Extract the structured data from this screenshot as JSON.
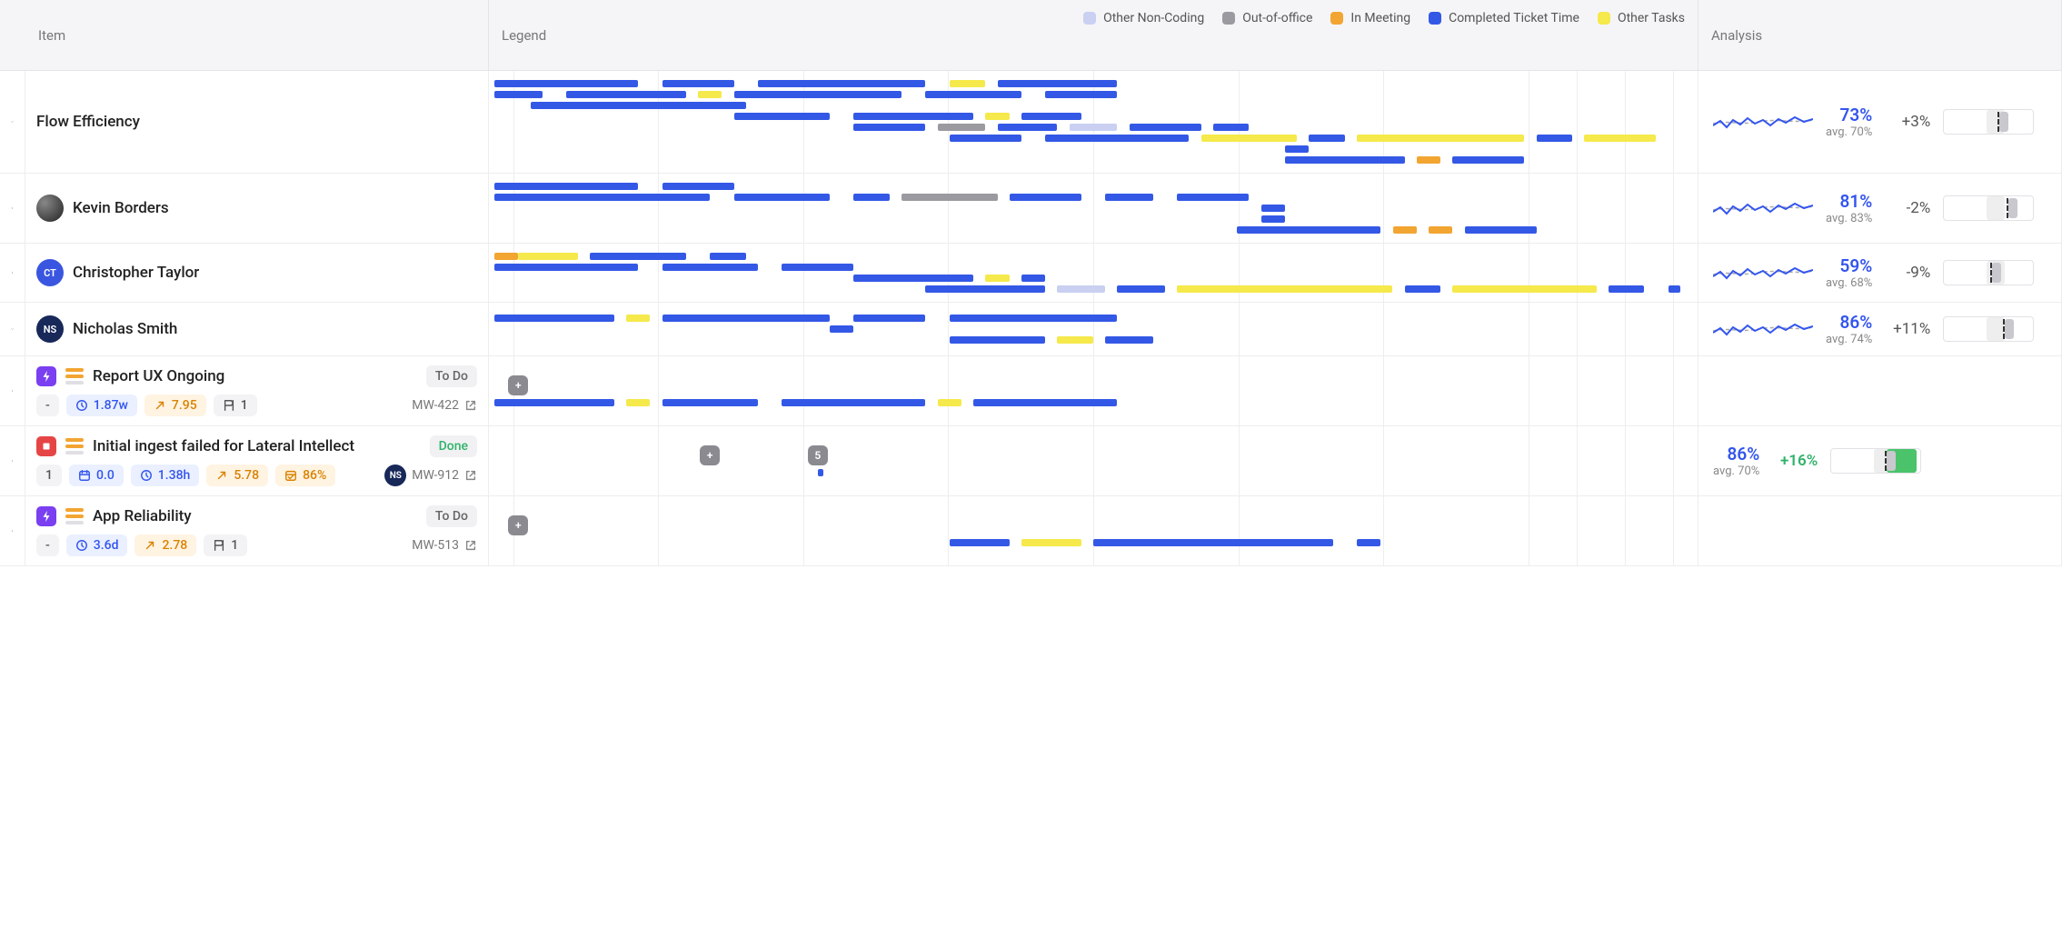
{
  "colors": {
    "blue": "#3458e6",
    "yellow": "#f5e94b",
    "lavender": "#c9d0f2",
    "grey": "#9a9aa0",
    "orange": "#f2a531",
    "green_bar": "#4bc36b"
  },
  "headers": {
    "item": "Item",
    "legend": "Legend",
    "analysis": "Analysis"
  },
  "legend": [
    {
      "label": "Other Non-Coding",
      "color": "lavender"
    },
    {
      "label": "Out-of-office",
      "color": "grey"
    },
    {
      "label": "In Meeting",
      "color": "orange"
    },
    {
      "label": "Completed Ticket Time",
      "color": "blue"
    },
    {
      "label": "Other Tasks",
      "color": "yellow"
    }
  ],
  "grid_lines_pct": [
    2,
    14,
    26,
    38,
    50,
    62,
    74,
    86,
    90,
    94,
    98
  ],
  "rows": [
    {
      "kind": "group",
      "expanded": true,
      "selected": true,
      "title": "Flow Efficiency",
      "analysis": {
        "spark": true,
        "value": "73%",
        "avg": "avg. 70%",
        "delta": "+3%",
        "knob_pct": 60
      },
      "tracks": [
        [
          {
            "c": "blue",
            "s": 0,
            "w": 12
          },
          {
            "c": "blue",
            "s": 14,
            "w": 6
          },
          {
            "c": "blue",
            "s": 22,
            "w": 14
          },
          {
            "c": "yellow",
            "s": 38,
            "w": 3
          },
          {
            "c": "blue",
            "s": 42,
            "w": 10
          }
        ],
        [
          {
            "c": "blue",
            "s": 0,
            "w": 4
          },
          {
            "c": "blue",
            "s": 6,
            "w": 10
          },
          {
            "c": "yellow",
            "s": 17,
            "w": 2
          },
          {
            "c": "blue",
            "s": 20,
            "w": 14
          },
          {
            "c": "blue",
            "s": 36,
            "w": 8
          },
          {
            "c": "blue",
            "s": 46,
            "w": 6
          }
        ],
        [
          {
            "c": "blue",
            "s": 3,
            "w": 18
          }
        ],
        [
          {
            "c": "blue",
            "s": 20,
            "w": 8
          },
          {
            "c": "blue",
            "s": 30,
            "w": 10
          },
          {
            "c": "yellow",
            "s": 41,
            "w": 2
          },
          {
            "c": "blue",
            "s": 44,
            "w": 5
          }
        ],
        [
          {
            "c": "blue",
            "s": 30,
            "w": 6
          },
          {
            "c": "grey",
            "s": 37,
            "w": 4
          },
          {
            "c": "blue",
            "s": 42,
            "w": 5
          },
          {
            "c": "lavender",
            "s": 48,
            "w": 4
          },
          {
            "c": "blue",
            "s": 53,
            "w": 6
          },
          {
            "c": "blue",
            "s": 60,
            "w": 3
          }
        ],
        [
          {
            "c": "blue",
            "s": 38,
            "w": 6
          },
          {
            "c": "blue",
            "s": 46,
            "w": 12
          },
          {
            "c": "yellow",
            "s": 59,
            "w": 8
          },
          {
            "c": "blue",
            "s": 68,
            "w": 3
          },
          {
            "c": "yellow",
            "s": 72,
            "w": 14
          },
          {
            "c": "blue",
            "s": 87,
            "w": 3
          },
          {
            "c": "yellow",
            "s": 91,
            "w": 6
          }
        ],
        [
          {
            "c": "blue",
            "s": 66,
            "w": 2
          }
        ],
        [
          {
            "c": "blue",
            "s": 66,
            "w": 10
          },
          {
            "c": "orange",
            "s": 77,
            "w": 2
          },
          {
            "c": "blue",
            "s": 80,
            "w": 6
          }
        ]
      ]
    },
    {
      "kind": "person",
      "expanded": false,
      "title": "Kevin Borders",
      "avatar": {
        "type": "img"
      },
      "analysis": {
        "spark": true,
        "value": "81%",
        "avg": "avg. 83%",
        "delta": "-2%",
        "knob_pct": 70
      },
      "tracks": [
        [
          {
            "c": "blue",
            "s": 0,
            "w": 12
          },
          {
            "c": "blue",
            "s": 14,
            "w": 6
          }
        ],
        [
          {
            "c": "blue",
            "s": 0,
            "w": 18
          },
          {
            "c": "blue",
            "s": 20,
            "w": 8
          },
          {
            "c": "blue",
            "s": 30,
            "w": 3
          },
          {
            "c": "grey",
            "s": 34,
            "w": 8
          },
          {
            "c": "blue",
            "s": 43,
            "w": 6
          },
          {
            "c": "blue",
            "s": 51,
            "w": 4
          },
          {
            "c": "blue",
            "s": 57,
            "w": 6
          }
        ],
        [
          {
            "c": "blue",
            "s": 64,
            "w": 2
          }
        ],
        [
          {
            "c": "blue",
            "s": 64,
            "w": 2
          }
        ],
        [
          {
            "c": "blue",
            "s": 62,
            "w": 12
          },
          {
            "c": "orange",
            "s": 75,
            "w": 2
          },
          {
            "c": "orange",
            "s": 78,
            "w": 2
          },
          {
            "c": "blue",
            "s": 81,
            "w": 6
          }
        ]
      ]
    },
    {
      "kind": "person",
      "expanded": false,
      "title": "Christopher Taylor",
      "avatar": {
        "type": "init",
        "text": "CT",
        "bg": "#3a56e0"
      },
      "analysis": {
        "spark": true,
        "value": "59%",
        "avg": "avg. 68%",
        "delta": "-9%",
        "knob_pct": 52
      },
      "tracks": [
        [
          {
            "c": "orange",
            "s": 0,
            "w": 2
          },
          {
            "c": "yellow",
            "s": 2,
            "w": 5
          },
          {
            "c": "blue",
            "s": 8,
            "w": 8
          },
          {
            "c": "blue",
            "s": 18,
            "w": 3
          }
        ],
        [
          {
            "c": "blue",
            "s": 0,
            "w": 12
          },
          {
            "c": "blue",
            "s": 14,
            "w": 8
          },
          {
            "c": "blue",
            "s": 24,
            "w": 6
          }
        ],
        [
          {
            "c": "blue",
            "s": 30,
            "w": 10
          },
          {
            "c": "yellow",
            "s": 41,
            "w": 2
          },
          {
            "c": "blue",
            "s": 44,
            "w": 2
          }
        ],
        [
          {
            "c": "blue",
            "s": 36,
            "w": 10
          },
          {
            "c": "lavender",
            "s": 47,
            "w": 4
          },
          {
            "c": "blue",
            "s": 52,
            "w": 4
          },
          {
            "c": "yellow",
            "s": 57,
            "w": 18
          },
          {
            "c": "blue",
            "s": 76,
            "w": 3
          },
          {
            "c": "yellow",
            "s": 80,
            "w": 12
          },
          {
            "c": "blue",
            "s": 93,
            "w": 3
          },
          {
            "c": "blue",
            "s": 98,
            "w": 1
          }
        ]
      ]
    },
    {
      "kind": "person",
      "expanded": true,
      "title": "Nicholas Smith",
      "avatar": {
        "type": "init",
        "text": "NS",
        "bg": "#172859"
      },
      "analysis": {
        "spark": true,
        "value": "86%",
        "avg": "avg. 74%",
        "delta": "+11%",
        "knob_pct": 66
      },
      "tracks": [
        [
          {
            "c": "blue",
            "s": 0,
            "w": 10
          },
          {
            "c": "yellow",
            "s": 11,
            "w": 2
          },
          {
            "c": "blue",
            "s": 14,
            "w": 14
          },
          {
            "c": "blue",
            "s": 30,
            "w": 6
          },
          {
            "c": "blue",
            "s": 38,
            "w": 14
          }
        ],
        [
          {
            "c": "blue",
            "s": 28,
            "w": 2
          }
        ],
        [
          {
            "c": "blue",
            "s": 38,
            "w": 8
          },
          {
            "c": "yellow",
            "s": 47,
            "w": 3
          },
          {
            "c": "blue",
            "s": 51,
            "w": 4
          }
        ]
      ]
    },
    {
      "kind": "ticket",
      "title": "Report UX Ongoing",
      "status": {
        "text": "To Do",
        "cls": ""
      },
      "type_icon": {
        "bg": "#7a3ff0",
        "glyph": "bolt"
      },
      "priority": [
        "#f2a531",
        "#f2a531",
        "#e0e0e4"
      ],
      "badges": [
        {
          "cls": "",
          "text": "-"
        },
        {
          "cls": "blue",
          "icon": "clock",
          "text": "1.87w"
        },
        {
          "cls": "orange",
          "icon": "arrow-up-right",
          "text": "7.95"
        },
        {
          "cls": "",
          "icon": "flag",
          "text": "1"
        }
      ],
      "ticket": "MW-422",
      "markers": [
        {
          "pct": 2,
          "text": "+"
        }
      ],
      "tracks": [
        [
          {
            "c": "blue",
            "s": 0,
            "w": 10
          },
          {
            "c": "yellow",
            "s": 11,
            "w": 2
          },
          {
            "c": "blue",
            "s": 14,
            "w": 8
          },
          {
            "c": "blue",
            "s": 24,
            "w": 12
          },
          {
            "c": "yellow",
            "s": 37,
            "w": 2
          },
          {
            "c": "blue",
            "s": 40,
            "w": 12
          }
        ]
      ]
    },
    {
      "kind": "ticket",
      "title": "Initial ingest failed for Lateral Intellect",
      "status": {
        "text": "Done",
        "cls": "done"
      },
      "type_icon": {
        "bg": "#e64545",
        "glyph": "stop"
      },
      "priority": [
        "#f2a531",
        "#f2a531",
        "#e0e0e4"
      ],
      "badges": [
        {
          "cls": "",
          "text": "1"
        },
        {
          "cls": "blue",
          "icon": "calendar",
          "text": "0.0"
        },
        {
          "cls": "blue",
          "icon": "clock",
          "text": "1.38h"
        },
        {
          "cls": "orange",
          "icon": "arrow-up-right",
          "text": "5.78"
        },
        {
          "cls": "orange",
          "icon": "calendar-check",
          "text": "86%"
        }
      ],
      "assignee": {
        "text": "NS",
        "bg": "#172859"
      },
      "ticket": "MW-912",
      "markers": [
        {
          "pct": 18,
          "text": "+"
        },
        {
          "pct": 27,
          "text": "5"
        }
      ],
      "tracks": [
        [
          {
            "c": "blue",
            "s": 27,
            "w": 0.5
          }
        ]
      ],
      "analysis": {
        "value": "86%",
        "avg": "avg. 70%",
        "delta": "+16%",
        "delta_cls": "pos",
        "bar_green": true,
        "knob_pct": 60,
        "green_start": 62,
        "green_w": 34
      }
    },
    {
      "kind": "ticket",
      "title": "App Reliability",
      "status": {
        "text": "To Do",
        "cls": ""
      },
      "type_icon": {
        "bg": "#7a3ff0",
        "glyph": "bolt"
      },
      "priority": [
        "#f2a531",
        "#f2a531",
        "#e0e0e4"
      ],
      "badges": [
        {
          "cls": "",
          "text": "-"
        },
        {
          "cls": "blue",
          "icon": "clock",
          "text": "3.6d"
        },
        {
          "cls": "orange",
          "icon": "arrow-up-right",
          "text": "2.78"
        },
        {
          "cls": "",
          "icon": "flag",
          "text": "1"
        }
      ],
      "ticket": "MW-513",
      "markers": [
        {
          "pct": 2,
          "text": "+"
        }
      ],
      "tracks": [
        [
          {
            "c": "blue",
            "s": 38,
            "w": 5
          },
          {
            "c": "yellow",
            "s": 44,
            "w": 5
          },
          {
            "c": "blue",
            "s": 50,
            "w": 20
          },
          {
            "c": "blue",
            "s": 72,
            "w": 2
          }
        ]
      ]
    }
  ]
}
